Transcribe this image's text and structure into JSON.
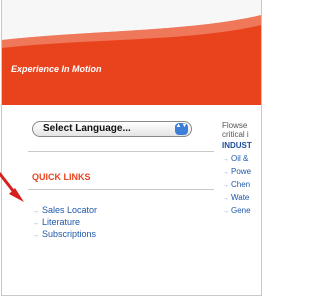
{
  "banner": {
    "tagline": "Experience In Motion"
  },
  "language_select": {
    "label": "Select Language...",
    "arrows": "▲▼"
  },
  "quick_links": {
    "title": "QUICK LINKS",
    "arrow": "→",
    "items": [
      {
        "label": "Sales Locator"
      },
      {
        "label": "Literature"
      },
      {
        "label": "Subscriptions"
      }
    ]
  },
  "right_panel": {
    "intro_line1": "Flowse",
    "intro_line2": "critical i",
    "industries_title": "INDUST",
    "arrow": "→",
    "items": [
      {
        "label": "Oil &"
      },
      {
        "label": "Powe"
      },
      {
        "label": "Chen"
      },
      {
        "label": "Wate"
      },
      {
        "label": "Gene"
      }
    ]
  },
  "colors": {
    "brand_orange": "#e9431e",
    "link_blue": "#1f58a8",
    "pointer_red": "#d81f1f"
  }
}
